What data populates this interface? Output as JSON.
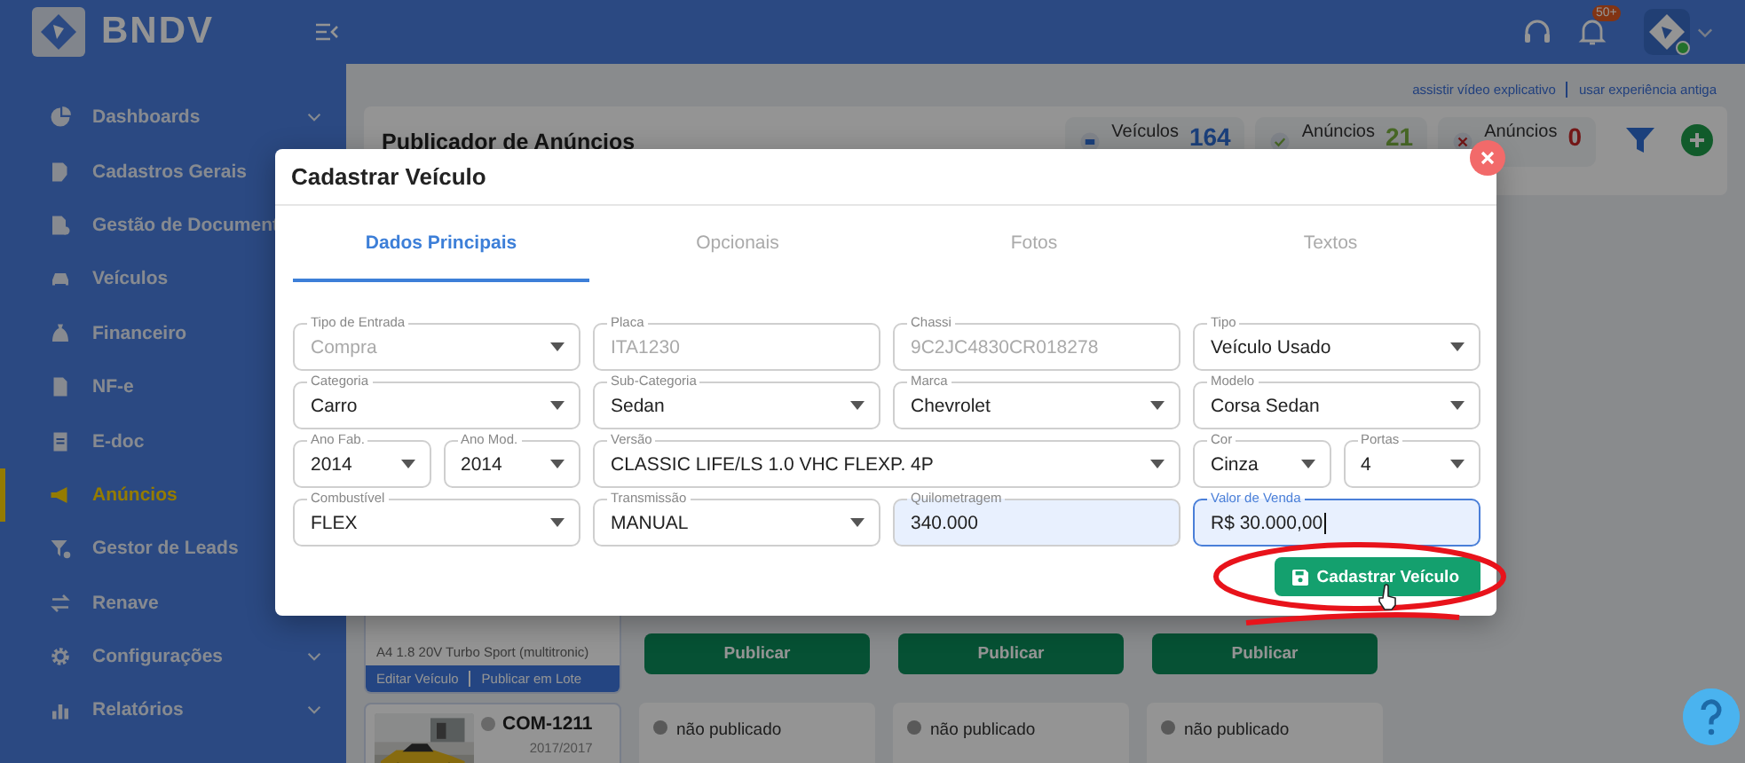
{
  "brand": {
    "name": "BNDV"
  },
  "topbar": {
    "notification_badge": "50+",
    "user_online": true
  },
  "sidebar": {
    "items": [
      {
        "label": "Dashboards",
        "expandable": true,
        "selected": false
      },
      {
        "label": "Cadastros Gerais",
        "selected": false
      },
      {
        "label": "Gestão de Document",
        "selected": false
      },
      {
        "label": "Veículos",
        "selected": false
      },
      {
        "label": "Financeiro",
        "selected": false
      },
      {
        "label": "NF-e",
        "selected": false
      },
      {
        "label": "E-doc",
        "selected": false
      },
      {
        "label": "Anúncios",
        "selected": true
      },
      {
        "label": "Gestor de Leads",
        "selected": false
      },
      {
        "label": "Renave",
        "selected": false
      },
      {
        "label": "Configurações",
        "expandable": true,
        "selected": false
      },
      {
        "label": "Relatórios",
        "expandable": true,
        "selected": false
      }
    ]
  },
  "header": {
    "links": [
      "assistir vídeo explicativo",
      "usar experiência antiga"
    ],
    "title": "Publicador de Anúncios",
    "stats": [
      {
        "label": "Veículos",
        "value": "164"
      },
      {
        "label": "Anúncios",
        "value": "21"
      },
      {
        "label": "Anúncios",
        "value": "0"
      }
    ]
  },
  "listing": {
    "vehicles": [
      {
        "subtitle": "A4 1.8 20V Turbo Sport (multitronic)",
        "actions": [
          "Editar Veículo",
          "Publicar em Lote"
        ]
      },
      {
        "code": "COM-1211",
        "year": "2017/2017",
        "published": false
      }
    ],
    "channels": [
      {
        "button": "Publicar",
        "status": "não publicado",
        "published": false
      },
      {
        "button": "Publicar",
        "status": "não publicado",
        "published": false
      },
      {
        "button": "Publicar",
        "status": "não publicado",
        "published": false
      }
    ]
  },
  "modal": {
    "title": "Cadastrar Veículo",
    "tabs": [
      {
        "label": "Dados Principais",
        "selected": true
      },
      {
        "label": "Opcionais",
        "selected": false
      },
      {
        "label": "Fotos",
        "selected": false
      },
      {
        "label": "Textos",
        "selected": false
      }
    ],
    "rows": [
      [
        {
          "label": "Tipo de Entrada",
          "value": "Compra",
          "kind": "select",
          "disabled": true,
          "highlighted": false,
          "focused": false
        },
        {
          "label": "Placa",
          "value": "ITA1230",
          "kind": "text",
          "disabled": true,
          "highlighted": false,
          "focused": false
        },
        {
          "label": "Chassi",
          "value": "9C2JC4830CR018278",
          "kind": "text",
          "disabled": true,
          "highlighted": false,
          "focused": false
        },
        {
          "label": "Tipo",
          "value": "Veículo Usado",
          "kind": "select",
          "disabled": false,
          "highlighted": false,
          "focused": false
        }
      ],
      [
        {
          "label": "Categoria",
          "value": "Carro",
          "kind": "select",
          "disabled": false,
          "highlighted": false,
          "focused": false
        },
        {
          "label": "Sub-Categoria",
          "value": "Sedan",
          "kind": "select",
          "disabled": false,
          "highlighted": false,
          "focused": false
        },
        {
          "label": "Marca",
          "value": "Chevrolet",
          "kind": "select",
          "disabled": false,
          "highlighted": false,
          "focused": false
        },
        {
          "label": "Modelo",
          "value": "Corsa Sedan",
          "kind": "select",
          "disabled": false,
          "highlighted": false,
          "focused": false
        }
      ],
      [
        {
          "label": "Ano Fab.",
          "value": "2014",
          "kind": "select",
          "disabled": false,
          "highlighted": false,
          "focused": false
        },
        {
          "label": "Ano Mod.",
          "value": "2014",
          "kind": "select",
          "disabled": false,
          "highlighted": false,
          "focused": false
        },
        {
          "label": "Versão",
          "value": "CLASSIC LIFE/LS 1.0 VHC FLEXP. 4P",
          "kind": "select",
          "disabled": false,
          "highlighted": false,
          "focused": false
        },
        {
          "label": "Cor",
          "value": "Cinza",
          "kind": "select",
          "disabled": false,
          "highlighted": false,
          "focused": false
        },
        {
          "label": "Portas",
          "value": "4",
          "kind": "select",
          "disabled": false,
          "highlighted": false,
          "focused": false
        }
      ],
      [
        {
          "label": "Combustível",
          "value": "FLEX",
          "kind": "select",
          "disabled": false,
          "highlighted": false,
          "focused": false
        },
        {
          "label": "Transmissão",
          "value": "MANUAL",
          "kind": "select",
          "disabled": false,
          "highlighted": false,
          "focused": false
        },
        {
          "label": "Quilometragem",
          "value": "340.000",
          "kind": "text",
          "disabled": false,
          "highlighted": true,
          "focused": false
        },
        {
          "label": "Valor de Venda",
          "value": "R$ 30.000,00",
          "kind": "text",
          "disabled": false,
          "highlighted": true,
          "focused": true
        }
      ]
    ],
    "submit": "Cadastrar Veículo"
  }
}
